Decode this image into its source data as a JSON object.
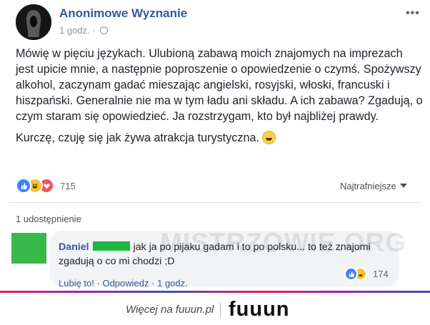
{
  "post": {
    "page_name": "Anonimowe Wyznanie",
    "time": "1 godz.",
    "separator": "·",
    "more_label": "•••",
    "paragraphs": [
      "Mówię w pięciu językach. Ulubioną zabawą moich znajomych na imprezach jest upicie mnie, a następnie poproszenie o opowiedzenie o czymś. Spożywszy alkohol, zaczynam gadać mieszając angielski, rosyjski, włoski, francuski i hiszpański. Generalnie nie ma w tym ładu ani składu. A ich zabawa? Zgadują, o czym staram się opowiedzieć. Ja rozstrzygam, kto był najbliżej prawdy.",
      "Kurczę, czuję się jak żywa atrakcja turystyczna."
    ],
    "reaction_count": "715",
    "sort_label": "Najtrafniejsze",
    "shares_label": "1 udostępnienie"
  },
  "comment": {
    "author": "Daniel",
    "text": "jak ja po pijaku gadam i to po polsku... to też znajomi zgadują o co mi chodzi ;D",
    "reaction_count": "174",
    "like_label": "Lubię to!",
    "reply_label": "Odpowiedz",
    "time": "1 godz.",
    "separator": "·"
  },
  "watermark": "MISTRZOWIE.ORG",
  "footer": {
    "text": "Więcej na fuuun.pl",
    "logo": "fuuun"
  },
  "colors": {
    "link": "#365899",
    "like": "#4080ff",
    "love": "#f25268",
    "haha": "#f7c531",
    "redaction": "#1eb640"
  },
  "icons": [
    "avatar-image",
    "globe-icon",
    "smile-emoji",
    "like-reaction-icon",
    "haha-reaction-icon",
    "love-reaction-icon",
    "dropdown-arrow-icon"
  ]
}
